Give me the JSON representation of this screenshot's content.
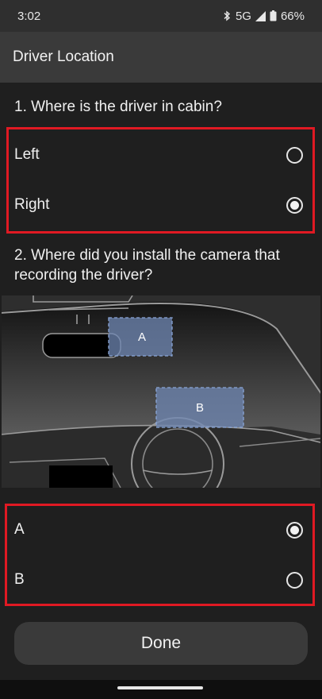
{
  "status": {
    "time": "3:02",
    "network": "5G",
    "battery": "66%"
  },
  "app_bar": {
    "title": "Driver Location"
  },
  "question1": {
    "text": "1. Where is the driver in cabin?",
    "options": [
      {
        "label": "Left",
        "selected": false
      },
      {
        "label": "Right",
        "selected": true
      }
    ]
  },
  "question2": {
    "text_line1": "2. Where did you install the camera that",
    "text_line2": "recording the driver?",
    "zones": {
      "a": "A",
      "b": "B"
    },
    "options": [
      {
        "label": "A",
        "selected": true
      },
      {
        "label": "B",
        "selected": false
      }
    ]
  },
  "done_label": "Done",
  "colors": {
    "highlight": "#e01923",
    "zone_fill": "#6f87b3",
    "zone_border": "#8aa6d8"
  }
}
